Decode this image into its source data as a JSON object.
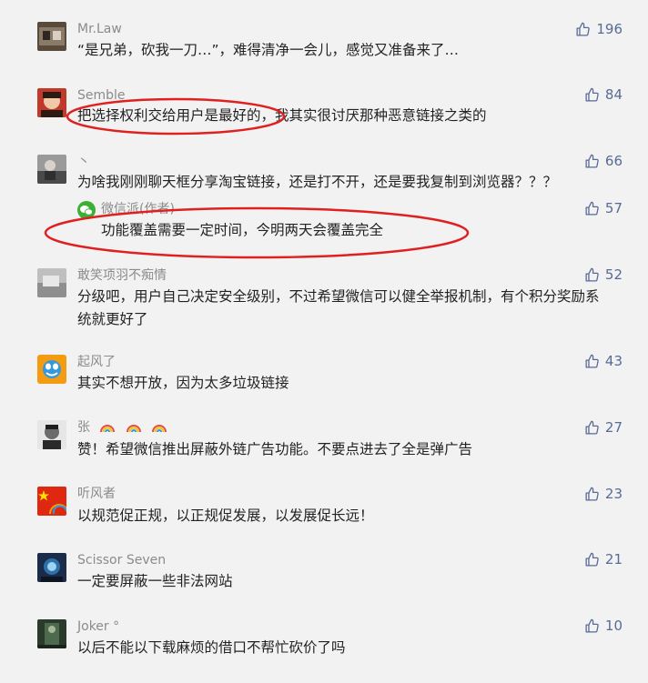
{
  "comments": [
    {
      "nick": "Mr.Law",
      "content": "“是兄弟，砍我一刀…”，难得清净一会儿，感觉又准备来了…",
      "likes": "196"
    },
    {
      "nick": "Semble",
      "content": "把选择权利交给用户是最好的，我其实很讨厌那种恶意链接之类的",
      "likes": "84"
    },
    {
      "nick": "丶",
      "content": "为啥我刚刚聊天框分享淘宝链接，还是打不开，还是要我复制到浏览器？？？",
      "likes": "66",
      "reply": {
        "nick": "微信派(作者)",
        "content": "功能覆盖需要一定时间，今明两天会覆盖完全",
        "likes": "57"
      }
    },
    {
      "nick": "敢笑项羽不痴情",
      "content": "分级吧，用户自己决定安全级别，不过希望微信可以健全举报机制，有个积分奖励系统就更好了",
      "likes": "52"
    },
    {
      "nick": "起风了",
      "content": "其实不想开放，因为太多垃圾链接",
      "likes": "43"
    },
    {
      "nick": "张",
      "content": "赞！希望微信推出屏蔽外链广告功能。不要点进去了全是弹广告",
      "likes": "27"
    },
    {
      "nick": "听风者",
      "content": "以规范促正规，以正规促发展，以发展促长远！",
      "likes": "23"
    },
    {
      "nick": "Scissor Seven",
      "content": "一定要屏蔽一些非法网站",
      "likes": "21"
    },
    {
      "nick": "Joker °",
      "content": "以后不能以下载麻烦的借口不帮忙砍价了吗",
      "likes": "10"
    }
  ],
  "colors": {
    "like": "#576b95",
    "annotation": "#e02020"
  },
  "icons": {
    "like": "thumbs-up-icon",
    "rainbow": "rainbow-icon"
  }
}
